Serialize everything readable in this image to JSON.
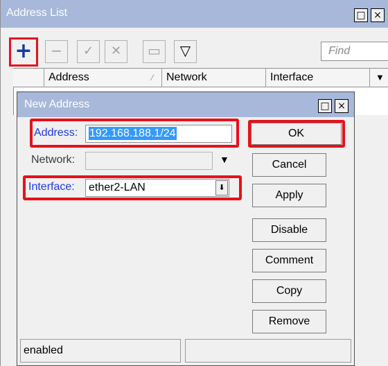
{
  "address_list_window": {
    "title": "Address List",
    "controls": [
      "□",
      "×"
    ],
    "toolbar": {
      "add": "+",
      "remove": "−",
      "enable": "✓",
      "disable": "✕",
      "comment": "▭",
      "filter": "▽"
    },
    "find_placeholder": "Find",
    "columns": [
      "Address",
      "Network",
      "Interface"
    ],
    "sort_indicator": "⁄",
    "column_dropdown": "▼"
  },
  "new_address_dialog": {
    "title": "New Address",
    "controls": [
      "□",
      "×"
    ],
    "fields": {
      "address_label": "Address:",
      "address_value": "192.168.188.1/24",
      "network_label": "Network:",
      "network_value": "",
      "network_arrow": "▼",
      "interface_label": "Interface:",
      "interface_value": "ether2-LAN",
      "interface_arrow": "⬇"
    },
    "buttons": [
      "OK",
      "Cancel",
      "Apply",
      "Disable",
      "Comment",
      "Copy",
      "Remove"
    ],
    "status": [
      "enabled",
      ""
    ]
  },
  "colors": {
    "titlebar": "#a7b8da",
    "highlight": "#e8101a",
    "label_blue": "#1d3ae6",
    "selection": "#3399ff"
  }
}
